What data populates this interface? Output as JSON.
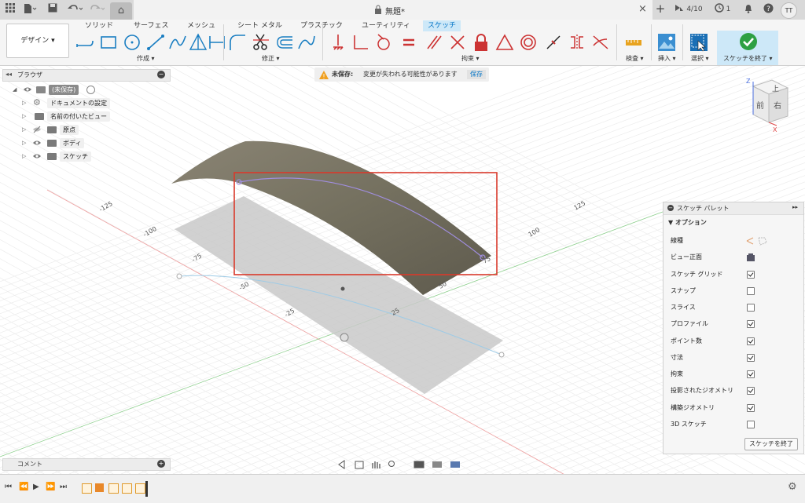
{
  "titlebar": {
    "doc_title": "無題*",
    "job_count": "4/10",
    "notif_count": "1",
    "user_initials": "TT"
  },
  "ribbon": {
    "workspace": "デザイン",
    "tabs": [
      "ソリッド",
      "サーフェス",
      "メッシュ",
      "シート メタル",
      "プラスチック",
      "ユーティリティ",
      "スケッチ"
    ],
    "active_tab": "スケッチ",
    "groups": {
      "create": "作成",
      "modify": "修正",
      "constraints": "拘束",
      "inspect": "検査",
      "insert": "挿入",
      "select": "選択",
      "finish": "スケッチを終了"
    }
  },
  "warning": {
    "title": "未保存:",
    "message": "変更が失われる可能性があります",
    "action": "保存"
  },
  "browser": {
    "title": "ブラウザ",
    "root": "(未保存)",
    "items": [
      "ドキュメントの設定",
      "名前の付いたビュー",
      "原点",
      "ボディ",
      "スケッチ"
    ]
  },
  "viewcube": {
    "top": "上",
    "front": "前",
    "right": "右",
    "axis_z": "Z",
    "axis_x": "X"
  },
  "axis_labels": {
    "x_axis": [
      "-125",
      "-100",
      "-75",
      "-50",
      "-25"
    ],
    "y_axis": [
      "25",
      "50",
      "75",
      "100",
      "125"
    ]
  },
  "palette": {
    "title": "スケッチ パレット",
    "section": "オプション",
    "rows": [
      {
        "label": "線種",
        "kind": "icon"
      },
      {
        "label": "ビュー正面",
        "kind": "icon"
      },
      {
        "label": "スケッチ グリッド",
        "checked": true
      },
      {
        "label": "スナップ",
        "checked": false
      },
      {
        "label": "スライス",
        "checked": false
      },
      {
        "label": "プロファイル",
        "checked": true
      },
      {
        "label": "ポイント数",
        "checked": true
      },
      {
        "label": "寸法",
        "checked": true
      },
      {
        "label": "拘束",
        "checked": true
      },
      {
        "label": "投影されたジオメトリ",
        "checked": true
      },
      {
        "label": "構築ジオメトリ",
        "checked": true
      },
      {
        "label": "3D スケッチ",
        "checked": false
      }
    ],
    "finish_button": "スケッチを終了"
  },
  "comment": {
    "title": "コメント"
  },
  "colors": {
    "accent": "#0696d7",
    "highlight_box": "#d9392b",
    "surface": "#77705f",
    "warning": "#f0a020"
  }
}
